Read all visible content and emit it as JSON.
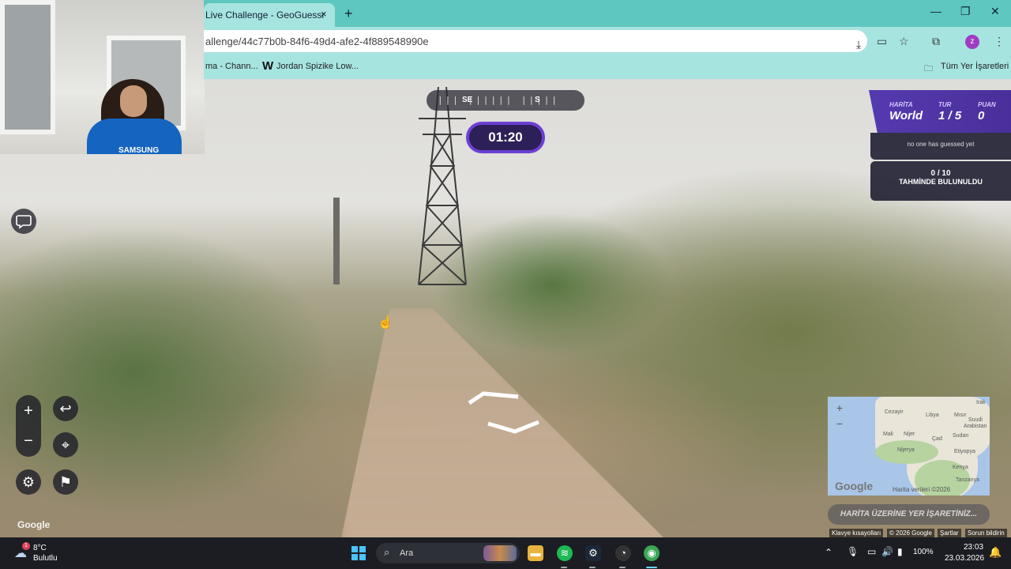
{
  "browser": {
    "tab_title": "Live Challenge - GeoGuessr",
    "tab_close_icon": "×",
    "new_tab_icon": "+",
    "address": "allenge/44c77b0b-84f6-49d4-afe2-4f889548990e",
    "profile_initial": "z",
    "bookmarks": [
      "ma - Chann...",
      "Jordan Spizike Low..."
    ],
    "bookmarks_all": "Tüm Yer İşaretleri"
  },
  "webcam": {
    "shirt_text": "SAMSUNG"
  },
  "compass": {
    "label_a": "SE",
    "label_b": "S"
  },
  "game": {
    "timer": "01:20",
    "map_label": "HARİTA",
    "map_value": "World",
    "round_label": "TUR",
    "round_value": "1 / 5",
    "score_label": "PUAN",
    "score_value": "0",
    "guess_status": "no one has guessed yet",
    "guess_count": "0 / 10",
    "guess_text": "TAHMİNDE BULUNULDU",
    "guess_button": "HARİTA ÜZERİNE YER İŞARETİNİZ..."
  },
  "controls": {
    "zoom_in": "+",
    "zoom_out": "−",
    "undo": "↩",
    "checkpoint": "⌖",
    "settings": "⚙",
    "flag": "⚑"
  },
  "street_view": {
    "google": "Google"
  },
  "minimap": {
    "labels": [
      "Cezayir",
      "Libya",
      "Mısır",
      "Suudi",
      "Arabistan",
      "Mali",
      "Nijer",
      "Çad",
      "Sudan",
      "Nijerya",
      "Etiyopya",
      "Kenya",
      "Tanzanya",
      "Irak"
    ],
    "zoom_in": "+",
    "zoom_out": "−",
    "google": "Google",
    "attribution": "Harita verileri ©2026"
  },
  "footer": {
    "keyboard": "Klavye kısayolları",
    "copyright": "© 2026 Google",
    "terms": "Şartlar",
    "report": "Sorun bildirin"
  },
  "taskbar": {
    "weather_temp": "8°C",
    "weather_desc": "Bulutlu",
    "weather_badge": "1",
    "search_label": "Ara",
    "battery": "100%",
    "time": "23:03",
    "date": "23.03.2026"
  },
  "colors": {
    "browser_chrome": "#5ec7c0",
    "status_header": "#553ab0",
    "timer_border": "#6b3fd3",
    "taskbar": "#1c1d22"
  }
}
